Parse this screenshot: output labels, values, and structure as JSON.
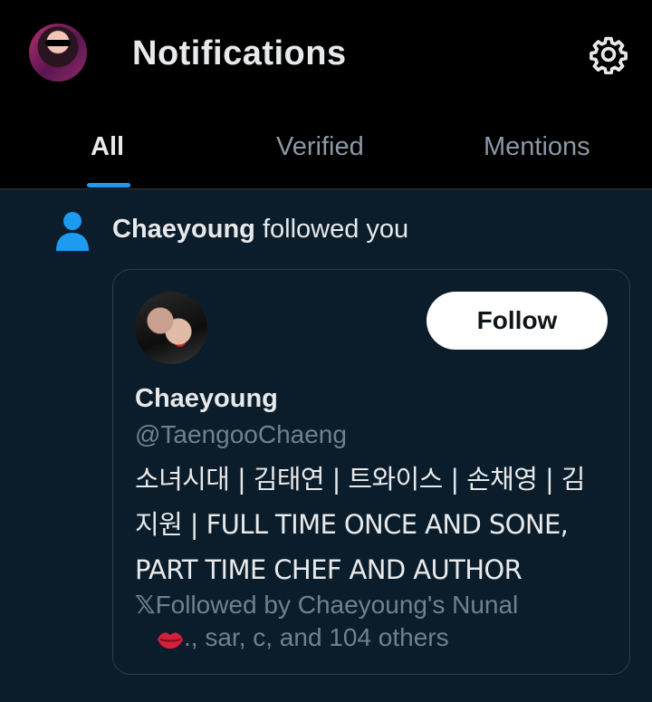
{
  "header": {
    "title": "Notifications",
    "avatar_icon": "profile-avatar",
    "settings_icon": "gear-icon"
  },
  "tabs": [
    {
      "label": "All",
      "active": true
    },
    {
      "label": "Verified",
      "active": false
    },
    {
      "label": "Mentions",
      "active": false
    }
  ],
  "notification": {
    "actor": "Chaeyoung",
    "action": " followed you",
    "icon": "person-icon",
    "card": {
      "name": "Chaeyoung",
      "handle": "@TaengooChaeng",
      "follow_label": "Follow",
      "bio": "소녀시대 | 김태연 | 트와이스 | 손채영 | 김지원 | FULL TIME ONCE AND SONE, PART TIME CHEF AND AUTHOR",
      "followed_by_prefix": "Followed by Chaeyoung's Nunal",
      "followed_by_rest": "., sar, c, and 104 others"
    }
  },
  "colors": {
    "accent": "#1d9bf0",
    "background": "#000000",
    "panel": "#0b1d2b",
    "secondary_text": "#71808f"
  }
}
